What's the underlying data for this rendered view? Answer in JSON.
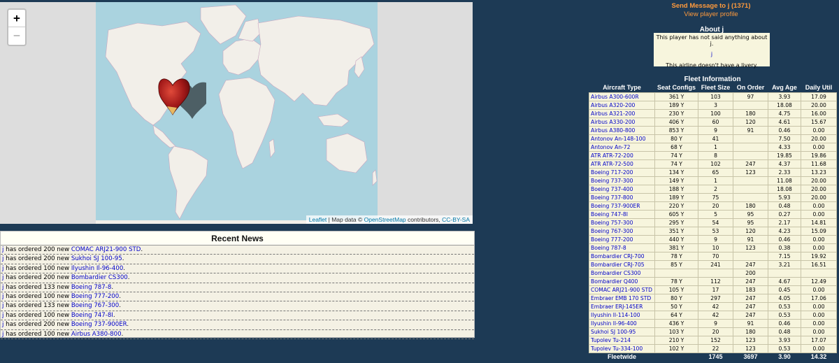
{
  "map": {
    "zoom_in": "+",
    "zoom_out": "−",
    "attribution": {
      "leaflet": "Leaflet",
      "sep": " | Map data © ",
      "osm": "OpenStreetMap",
      "contrib": " contributors, ",
      "license": "CC-BY-SA"
    },
    "colors": {
      "water": "#aad3df",
      "land": "#f2efe9",
      "outside": "#dddddd",
      "marker": "#c0392b"
    },
    "marker_icon": "heart-marker-icon"
  },
  "news": {
    "title": "Recent News",
    "items": [
      {
        "who": "j",
        "mid": " has ordered 200 new ",
        "aircraft": "COMAC ARJ21-900 STD",
        "end": "."
      },
      {
        "who": "j",
        "mid": " has ordered 200 new ",
        "aircraft": "Sukhoi SJ 100-95",
        "end": "."
      },
      {
        "who": "j",
        "mid": " has ordered 100 new ",
        "aircraft": "Ilyushin Il-96-400",
        "end": "."
      },
      {
        "who": "j",
        "mid": " has ordered 200 new ",
        "aircraft": "Bombardier CS300",
        "end": "."
      },
      {
        "who": "j",
        "mid": " has ordered 133 new ",
        "aircraft": "Boeing 787-8",
        "end": "."
      },
      {
        "who": "j",
        "mid": " has ordered 100 new ",
        "aircraft": "Boeing 777-200",
        "end": "."
      },
      {
        "who": "j",
        "mid": " has ordered 133 new ",
        "aircraft": "Boeing 767-300",
        "end": "."
      },
      {
        "who": "j",
        "mid": " has ordered 100 new ",
        "aircraft": "Boeing 747-8I",
        "end": "."
      },
      {
        "who": "j",
        "mid": " has ordered 200 new ",
        "aircraft": "Boeing 737-900ER",
        "end": "."
      },
      {
        "who": "j",
        "mid": " has ordered 100 new ",
        "aircraft": "Airbus A380-800",
        "end": "."
      }
    ]
  },
  "profile": {
    "send_message": "Send Message to j (1371)",
    "view_profile": "View player profile",
    "about_title": "About j",
    "about_text": "This player has not said anything about j.",
    "about_letter": "j",
    "livery_text": "This airline doesn't have a livery."
  },
  "fleet": {
    "title": "Fleet Information",
    "headers": [
      "Aircraft Type",
      "Seat Configs",
      "Fleet Size",
      "On Order",
      "Avg Age",
      "Daily Util"
    ],
    "rows": [
      [
        "Airbus A300-600R",
        "361 Y",
        "103",
        "97",
        "3.93",
        "17.09"
      ],
      [
        "Airbus A320-200",
        "189 Y",
        "3",
        "",
        "18.08",
        "20.00"
      ],
      [
        "Airbus A321-200",
        "230 Y",
        "100",
        "180",
        "4.75",
        "16.00"
      ],
      [
        "Airbus A330-200",
        "406 Y",
        "60",
        "120",
        "4.61",
        "15.67"
      ],
      [
        "Airbus A380-800",
        "853 Y",
        "9",
        "91",
        "0.46",
        "0.00"
      ],
      [
        "Antonov An-148-100",
        "80 Y",
        "41",
        "",
        "7.50",
        "20.00"
      ],
      [
        "Antonov An-72",
        "68 Y",
        "1",
        "",
        "4.33",
        "0.00"
      ],
      [
        "ATR ATR-72-200",
        "74 Y",
        "8",
        "",
        "19.85",
        "19.86"
      ],
      [
        "ATR ATR-72-500",
        "74 Y",
        "102",
        "247",
        "4.37",
        "11.68"
      ],
      [
        "Boeing 717-200",
        "134 Y",
        "65",
        "123",
        "2.33",
        "13.23"
      ],
      [
        "Boeing 737-300",
        "149 Y",
        "1",
        "",
        "11.08",
        "20.00"
      ],
      [
        "Boeing 737-400",
        "188 Y",
        "2",
        "",
        "18.08",
        "20.00"
      ],
      [
        "Boeing 737-800",
        "189 Y",
        "75",
        "",
        "5.93",
        "20.00"
      ],
      [
        "Boeing 737-900ER",
        "220 Y",
        "20",
        "180",
        "0.48",
        "0.00"
      ],
      [
        "Boeing 747-8I",
        "605 Y",
        "5",
        "95",
        "0.27",
        "0.00"
      ],
      [
        "Boeing 757-300",
        "295 Y",
        "54",
        "95",
        "2.17",
        "14.81"
      ],
      [
        "Boeing 767-300",
        "351 Y",
        "53",
        "120",
        "4.23",
        "15.09"
      ],
      [
        "Boeing 777-200",
        "440 Y",
        "9",
        "91",
        "0.46",
        "0.00"
      ],
      [
        "Boeing 787-8",
        "381 Y",
        "10",
        "123",
        "0.38",
        "0.00"
      ],
      [
        "Bombardier CRJ-700",
        "78 Y",
        "70",
        "",
        "7.15",
        "19.92"
      ],
      [
        "Bombardier CRJ-705",
        "85 Y",
        "241",
        "247",
        "3.21",
        "16.51"
      ],
      [
        "Bombardier CS300",
        "",
        "",
        "200",
        "",
        ""
      ],
      [
        "Bombardier Q400",
        "78 Y",
        "112",
        "247",
        "4.67",
        "12.49"
      ],
      [
        "COMAC ARJ21-900 STD",
        "105 Y",
        "17",
        "183",
        "0.45",
        "0.00"
      ],
      [
        "Embraer EMB 170 STD",
        "80 Y",
        "297",
        "247",
        "4.05",
        "17.06"
      ],
      [
        "Embraer ERJ-145ER",
        "50 Y",
        "42",
        "247",
        "0.53",
        "0.00"
      ],
      [
        "Ilyushin Il-114-100",
        "64 Y",
        "42",
        "247",
        "0.53",
        "0.00"
      ],
      [
        "Ilyushin Il-96-400",
        "436 Y",
        "9",
        "91",
        "0.46",
        "0.00"
      ],
      [
        "Sukhoi SJ 100-95",
        "103 Y",
        "20",
        "180",
        "0.48",
        "0.00"
      ],
      [
        "Tupolev Tu-214",
        "210 Y",
        "152",
        "123",
        "3.93",
        "17.07"
      ],
      [
        "Tupolev Tu-334-100",
        "102 Y",
        "22",
        "123",
        "0.53",
        "0.00"
      ]
    ],
    "footer": [
      "Fleetwide",
      "",
      "1745",
      "3697",
      "3.90",
      "14.32"
    ]
  }
}
